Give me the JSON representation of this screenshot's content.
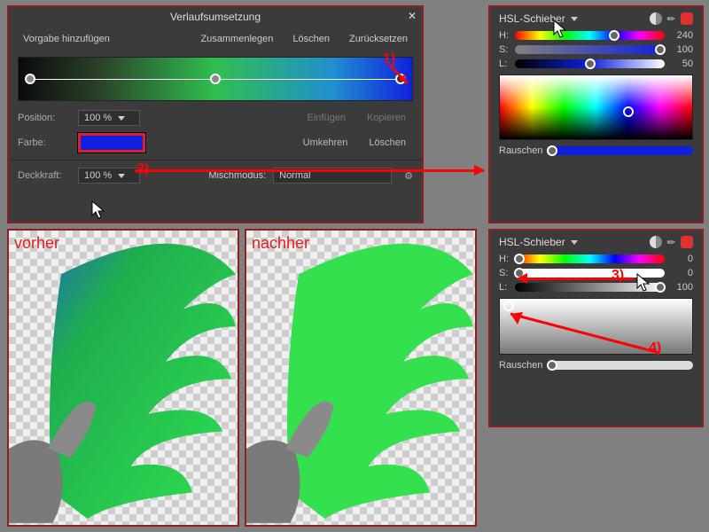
{
  "grad_panel": {
    "title": "Verlaufsumsetzung",
    "btns": {
      "add": "Vorgabe hinzufügen",
      "merge": "Zusammenlegen",
      "del": "Löschen",
      "reset": "Zurücksetzen"
    },
    "position_label": "Position:",
    "position_value": "100 %",
    "color_label": "Farbe:",
    "paste": "Einfügen",
    "copy": "Kopieren",
    "invert": "Umkehren",
    "delstop": "Löschen",
    "opacity_label": "Deckkraft:",
    "opacity_value": "100 %",
    "blend_label": "Mischmodus:",
    "blend_value": "Normal"
  },
  "hsl1": {
    "title": "HSL-Schieber",
    "h_label": "H:",
    "h_value": "240",
    "s_label": "S:",
    "s_value": "100",
    "l_label": "L:",
    "l_value": "50",
    "noise_label": "Rauschen"
  },
  "hsl2": {
    "title": "HSL-Schieber",
    "h_label": "H:",
    "h_value": "0",
    "s_label": "S:",
    "s_value": "0",
    "l_label": "L:",
    "l_value": "100",
    "noise_label": "Rauschen"
  },
  "preview": {
    "before": "vorher",
    "after": "nachher"
  },
  "annotations": {
    "a1": "1)",
    "a2": "2)",
    "a3": "3)",
    "a4": "4)"
  }
}
